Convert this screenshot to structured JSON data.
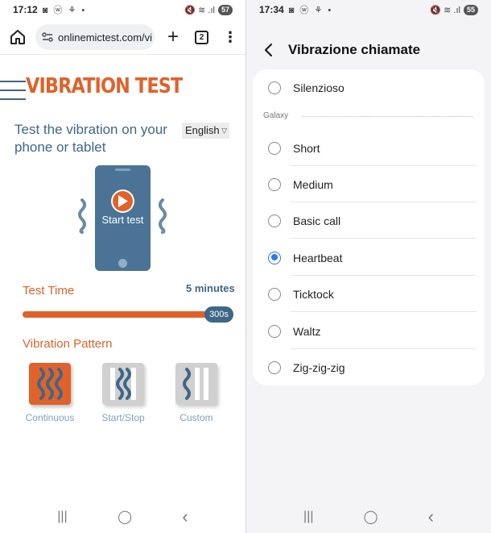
{
  "left": {
    "status": {
      "time": "17:12",
      "notif_icons": "◙ ⓦ ⚘ •",
      "right_icons": "🔇 ≋ .ıl",
      "battery": "57"
    },
    "browser": {
      "url": "onlinemictest.com/vi",
      "tab_count": "2"
    },
    "page": {
      "site_title": "VIBRATION TEST",
      "subtitle": "Test the vibration on your phone or tablet",
      "language": "English",
      "phone_button_label": "Start test",
      "test_time_label": "Test Time",
      "test_time_value": "5 minutes",
      "slider_value": "300s",
      "slider_fraction": 1.0,
      "pattern_label": "Vibration Pattern",
      "patterns": [
        {
          "label": "Continuous",
          "selected": true
        },
        {
          "label": "Start/Stop",
          "selected": false
        },
        {
          "label": "Custom",
          "selected": false
        }
      ],
      "colors": {
        "accent": "#e0622a",
        "primary": "#3f6686",
        "muted": "#7ea3bf"
      }
    }
  },
  "right": {
    "status": {
      "time": "17:34",
      "notif_icons": "◙ ⓦ ⚘ •",
      "right_icons": "🔇 ≋ .ıl",
      "battery": "55"
    },
    "header_title": "Vibrazione chiamate",
    "options": [
      {
        "label": "Silenzioso",
        "checked": false
      },
      {
        "label": "Short",
        "checked": false
      },
      {
        "label": "Medium",
        "checked": false
      },
      {
        "label": "Basic call",
        "checked": false
      },
      {
        "label": "Heartbeat",
        "checked": true
      },
      {
        "label": "Ticktock",
        "checked": false
      },
      {
        "label": "Waltz",
        "checked": false
      },
      {
        "label": "Zig-zig-zig",
        "checked": false
      }
    ],
    "group_header": "Galaxy",
    "colors": {
      "radio_checked": "#2f78e6"
    }
  },
  "navbar": {
    "recents": "|||",
    "home": "◯",
    "back": "‹"
  }
}
